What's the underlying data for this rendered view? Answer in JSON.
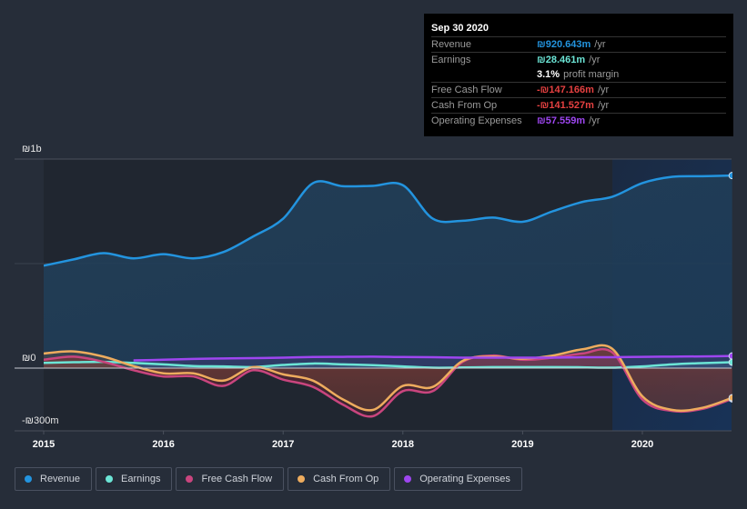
{
  "tooltip": {
    "date": "Sep 30 2020",
    "rows": [
      {
        "label": "Revenue",
        "value": "₪920.643m",
        "unit": "/yr",
        "color": "#2394df"
      },
      {
        "label": "Earnings",
        "value": "₪28.461m",
        "unit": "/yr",
        "color": "#6ce5d6"
      },
      {
        "label": "",
        "value": "3.1%",
        "unit": "profit margin",
        "color": "#ffffff"
      },
      {
        "label": "Free Cash Flow",
        "value": "-₪147.166m",
        "unit": "/yr",
        "color": "#e64141"
      },
      {
        "label": "Cash From Op",
        "value": "-₪141.527m",
        "unit": "/yr",
        "color": "#e64141"
      },
      {
        "label": "Operating Expenses",
        "value": "₪57.559m",
        "unit": "/yr",
        "color": "#9e46f0"
      }
    ]
  },
  "legend": [
    {
      "label": "Revenue",
      "color": "#2394df"
    },
    {
      "label": "Earnings",
      "color": "#6ce5d6"
    },
    {
      "label": "Free Cash Flow",
      "color": "#c9457e"
    },
    {
      "label": "Cash From Op",
      "color": "#eeac5e"
    },
    {
      "label": "Operating Expenses",
      "color": "#9e46f0"
    }
  ],
  "chart_data": {
    "type": "area",
    "currency": "₪",
    "ylim": [
      -300,
      1000
    ],
    "yticks": [
      {
        "value": 1000,
        "label": "₪1b"
      },
      {
        "value": 0,
        "label": "₪0"
      },
      {
        "value": -300,
        "label": "-₪300m"
      }
    ],
    "xlim": [
      2014.97,
      2020.75
    ],
    "xticks": [
      2015,
      2016,
      2017,
      2018,
      2019,
      2020
    ],
    "xtick_labels": [
      "2015",
      "2016",
      "2017",
      "2018",
      "2019",
      "2020"
    ],
    "highlight_start": 2019.75,
    "grid": true,
    "legend_position": "bottom",
    "x": [
      2015.0,
      2015.25,
      2015.5,
      2015.75,
      2016.0,
      2016.25,
      2016.5,
      2016.75,
      2017.0,
      2017.25,
      2017.5,
      2017.75,
      2018.0,
      2018.25,
      2018.5,
      2018.75,
      2019.0,
      2019.25,
      2019.5,
      2019.75,
      2020.0,
      2020.25,
      2020.5,
      2020.75
    ],
    "series": [
      {
        "name": "Revenue",
        "color": "#2394df",
        "values": [
          490,
          520,
          550,
          525,
          545,
          525,
          555,
          630,
          715,
          885,
          870,
          872,
          875,
          715,
          705,
          720,
          700,
          750,
          795,
          820,
          885,
          915,
          918,
          921
        ]
      },
      {
        "name": "Earnings",
        "color": "#6ce5d6",
        "values": [
          25,
          28,
          30,
          25,
          18,
          10,
          8,
          5,
          15,
          22,
          18,
          14,
          8,
          2,
          3,
          5,
          5,
          5,
          4,
          2,
          8,
          18,
          24,
          28
        ]
      },
      {
        "name": "Free Cash Flow",
        "color": "#c9457e",
        "values": [
          40,
          55,
          30,
          -10,
          -40,
          -40,
          -85,
          -10,
          -55,
          -90,
          -175,
          -230,
          -110,
          -110,
          30,
          60,
          40,
          50,
          70,
          75,
          -150,
          -205,
          -195,
          -147
        ]
      },
      {
        "name": "Cash From Op",
        "color": "#eeac5e",
        "values": [
          70,
          80,
          55,
          10,
          -25,
          -25,
          -60,
          5,
          -30,
          -60,
          -150,
          -200,
          -85,
          -90,
          35,
          55,
          45,
          60,
          90,
          92,
          -135,
          -200,
          -190,
          -142
        ]
      },
      {
        "name": "Operating Expenses",
        "color": "#9e46f0",
        "values": [
          null,
          null,
          null,
          37,
          40,
          44,
          46,
          48,
          50,
          53,
          54,
          55,
          53,
          52,
          50,
          50,
          50,
          50,
          52,
          52,
          54,
          55,
          56,
          58
        ]
      }
    ]
  }
}
